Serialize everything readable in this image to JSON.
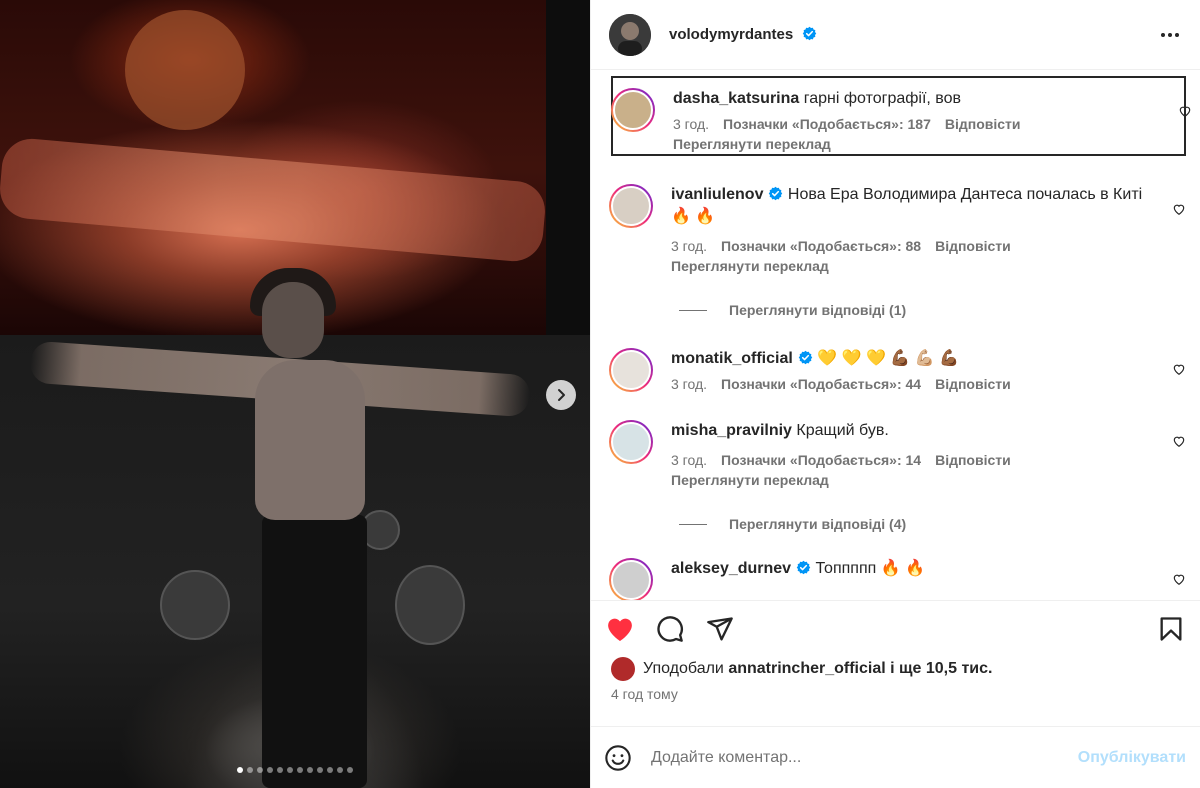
{
  "post": {
    "author": "volodymyrdantes",
    "verified": true,
    "image_count": 12,
    "active_image": 1
  },
  "comments": [
    {
      "username": "dasha_katsurina",
      "verified": false,
      "text": "гарні фотографії, вов",
      "time": "3 год.",
      "likes": "Позначки «Подобається»: 187",
      "reply": "Відповісти",
      "translate": "Переглянути переклад"
    },
    {
      "username": "ivanliulenov",
      "verified": true,
      "text": "Нова Ера Володимира Дантеса почалась в Киті 🔥 🔥",
      "time": "3 год.",
      "likes": "Позначки «Подобається»: 88",
      "reply": "Відповісти",
      "translate": "Переглянути переклад",
      "view_replies": "Переглянути відповіді (1)"
    },
    {
      "username": "monatik_official",
      "verified": true,
      "text": "💛 💛 💛 💪🏾 💪🏼 💪🏾",
      "time": "3 год.",
      "likes": "Позначки «Подобається»: 44",
      "reply": "Відповісти"
    },
    {
      "username": "misha_pravilniy",
      "verified": false,
      "text": "Кращий був.",
      "time": "3 год.",
      "likes": "Позначки «Подобається»: 14",
      "reply": "Відповісти",
      "translate": "Переглянути переклад",
      "view_replies": "Переглянути відповіді (4)"
    },
    {
      "username": "aleksey_durnev",
      "verified": true,
      "text": "Топпппп 🔥 🔥"
    }
  ],
  "actions": {
    "liked": true,
    "like_color": "#ff3040"
  },
  "likes": {
    "prefix": "Уподобали",
    "user": "annatrincher_official",
    "suffix": "і ще 10,5 тис."
  },
  "posted_time": "4 год тому",
  "add_comment": {
    "placeholder": "Додайте коментар...",
    "publish_label": "Опублікувати"
  },
  "colors": {
    "verified_blue": "#0095f6",
    "muted_text": "#737373",
    "publish_disabled": "#b2dffc"
  }
}
